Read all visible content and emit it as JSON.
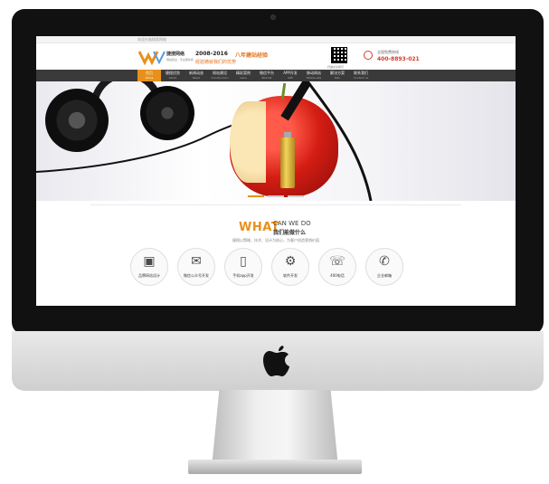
{
  "topbar": {
    "text": "欢迎光临搜索网络"
  },
  "header": {
    "logo_text": "捷搜网络",
    "logo_sub": "网站建设 · 专业服务商",
    "slogan_year": "2008-2016",
    "slogan_main": "八年建站经验",
    "slogan_sub": "经验铸就我们的优势",
    "qr_caption": "扫描关注我们",
    "phone_label": "全国免费热线",
    "phone_number": "400-8893-021"
  },
  "nav": {
    "items": [
      {
        "label": "首页",
        "en": "Home"
      },
      {
        "label": "捷搜优势",
        "en": "About"
      },
      {
        "label": "新闻动态",
        "en": "News"
      },
      {
        "label": "网站建设",
        "en": "Construction"
      },
      {
        "label": "精彩案例",
        "en": "Case"
      },
      {
        "label": "微信平台",
        "en": "Wechat"
      },
      {
        "label": "APP开发",
        "en": "APP"
      },
      {
        "label": "移动网站",
        "en": "Mobile site"
      },
      {
        "label": "解决方案",
        "en": "Plan"
      },
      {
        "label": "联系我们",
        "en": "Contact us"
      }
    ]
  },
  "services": {
    "what": "WHAT",
    "can_we_do": "CAN WE DO",
    "can_we_do_cn": "我们能做什么",
    "description": "捷搜以策略、技术、设计为核心，为客户创造营销价值",
    "items": [
      {
        "label": "品牌网站设计",
        "icon": "monitor-icon"
      },
      {
        "label": "微信公众号开发",
        "icon": "wechat-icon"
      },
      {
        "label": "手机app开发",
        "icon": "phone-icon"
      },
      {
        "label": "软件开发",
        "icon": "gears-icon"
      },
      {
        "label": "400电话",
        "icon": "headset-icon"
      },
      {
        "label": "企业邮箱",
        "icon": "mail-icon"
      }
    ]
  },
  "colors": {
    "accent": "#e8901b",
    "nav_bg": "#3a3a3a",
    "phone_red": "#d63a2b"
  }
}
